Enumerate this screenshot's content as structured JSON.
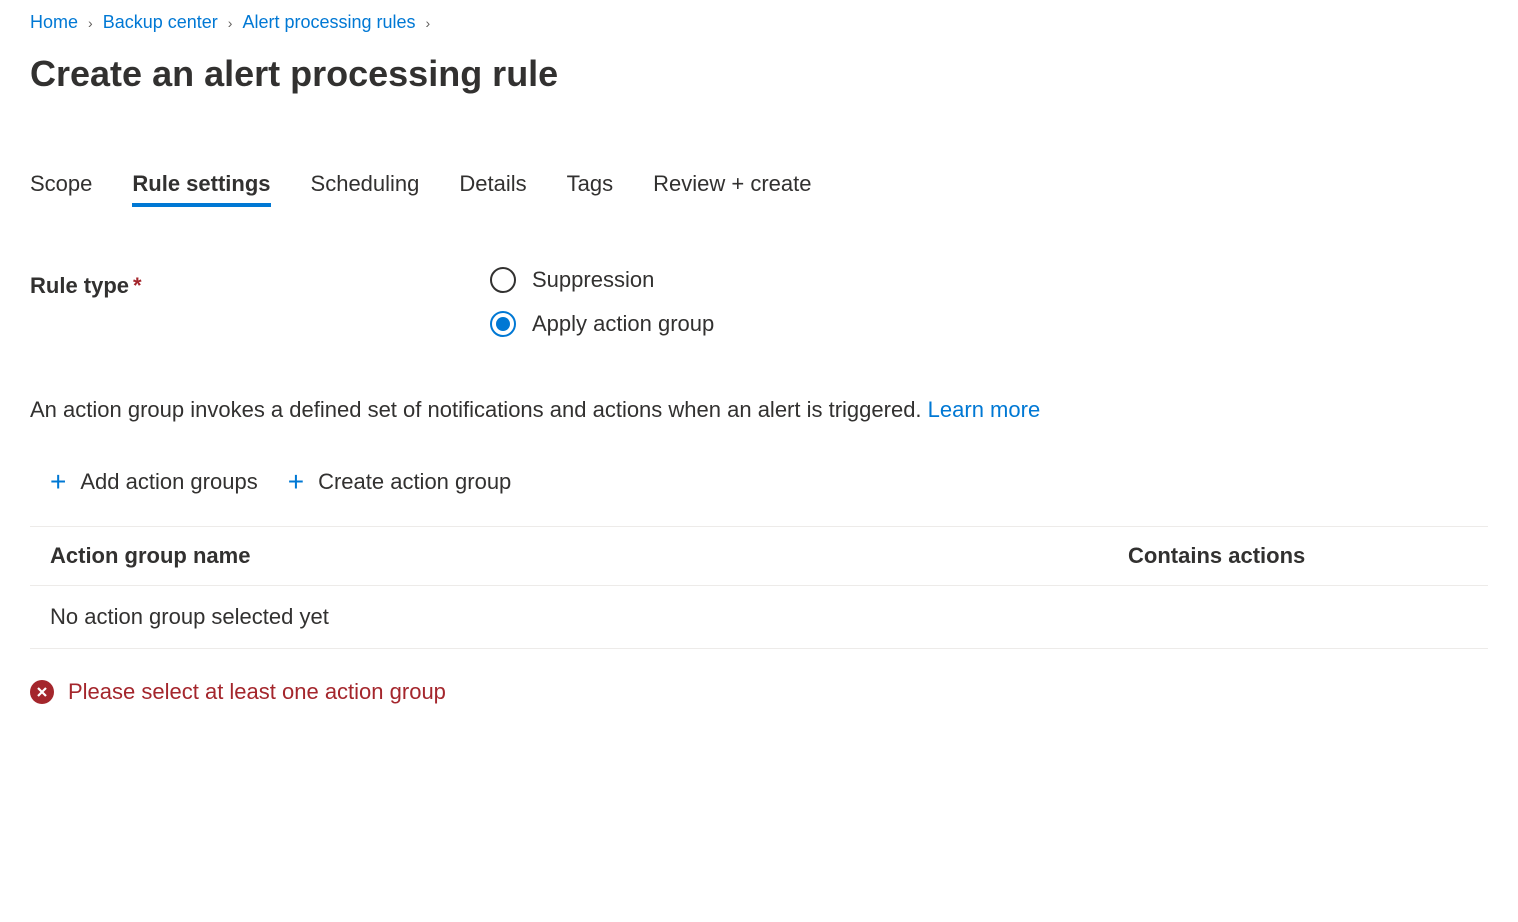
{
  "breadcrumb": {
    "items": [
      {
        "label": "Home"
      },
      {
        "label": "Backup center"
      },
      {
        "label": "Alert processing rules"
      }
    ]
  },
  "page_title": "Create an alert processing rule",
  "tabs": [
    {
      "label": "Scope",
      "active": false
    },
    {
      "label": "Rule settings",
      "active": true
    },
    {
      "label": "Scheduling",
      "active": false
    },
    {
      "label": "Details",
      "active": false
    },
    {
      "label": "Tags",
      "active": false
    },
    {
      "label": "Review + create",
      "active": false
    }
  ],
  "rule_type": {
    "label": "Rule type",
    "options": [
      {
        "label": "Suppression",
        "selected": false
      },
      {
        "label": "Apply action group",
        "selected": true
      }
    ]
  },
  "description_text": "An action group invokes a defined set of notifications and actions when an alert is triggered. ",
  "learn_more": "Learn more",
  "actions": {
    "add": "Add action groups",
    "create": "Create action group"
  },
  "table": {
    "col_name": "Action group name",
    "col_actions": "Contains actions",
    "empty_row": "No action group selected yet"
  },
  "error": "Please select at least one action group"
}
